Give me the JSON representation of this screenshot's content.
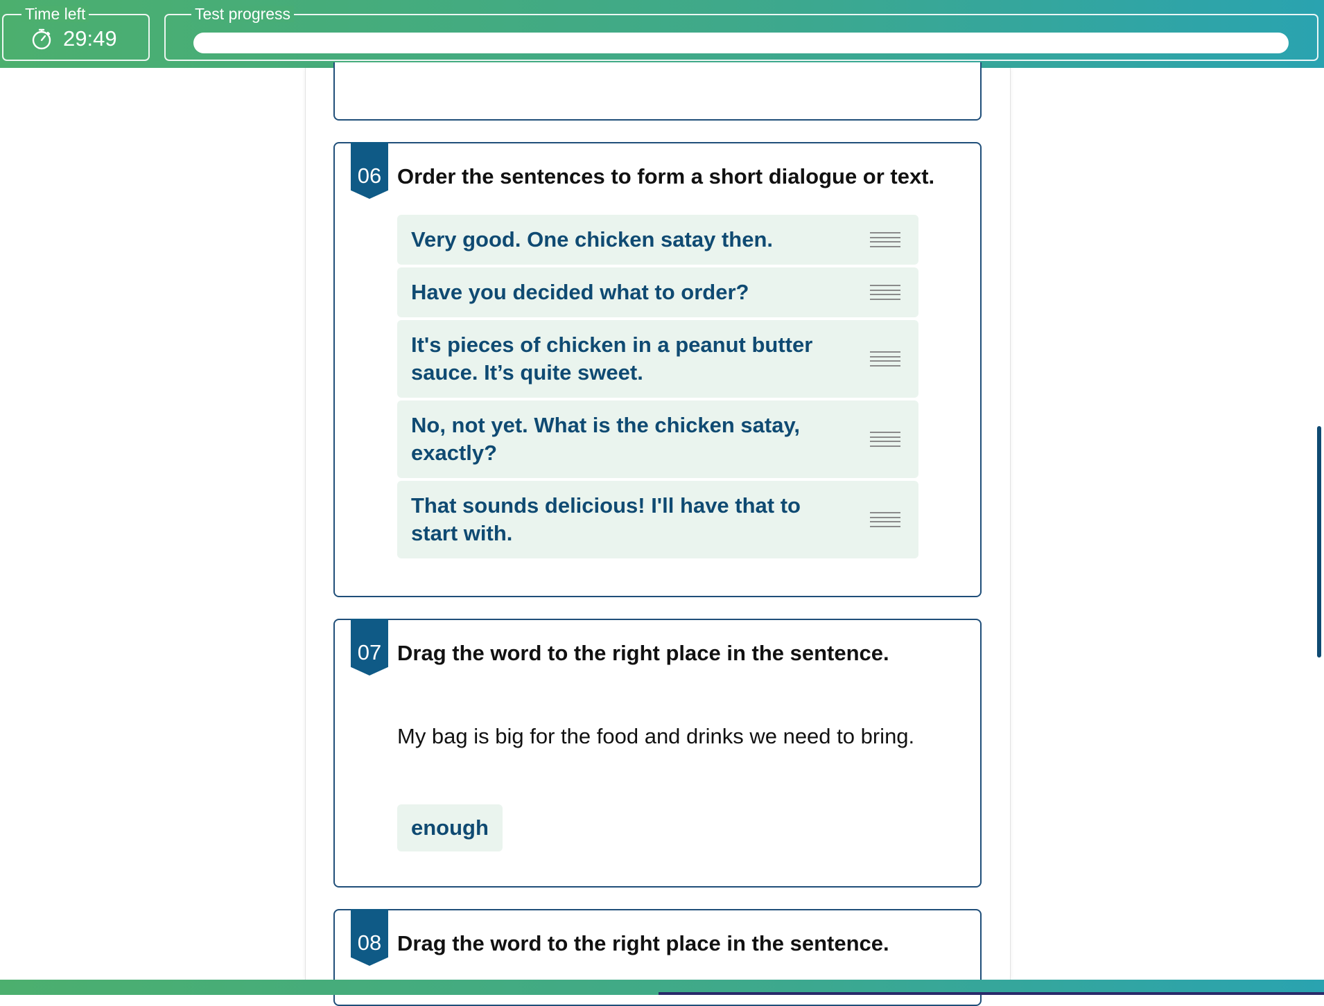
{
  "header": {
    "time_left_label": "Time left",
    "time_left_value": "29:49",
    "progress_label": "Test progress",
    "progress_fraction": 0.0
  },
  "questions": [
    {
      "number": "06",
      "title": "Order the sentences to form a short dialogue or text.",
      "items": [
        "Very good. One chicken satay then.",
        "Have you decided what to order?",
        "It's pieces of chicken in a peanut butter sauce. It’s quite sweet.",
        "No, not yet. What is the chicken satay, exactly?",
        "That sounds delicious! I'll have that to start with."
      ]
    },
    {
      "number": "07",
      "title": "Drag the word to the right place in the sentence.",
      "sentence": "My bag is big for the food and drinks we need to bring.",
      "word": "enough"
    },
    {
      "number": "08",
      "title": "Drag the word to the right place in the sentence."
    }
  ],
  "colors": {
    "header_gradient_start": "#4caf6e",
    "header_gradient_end": "#2aa3b0",
    "card_border": "#1f4e79",
    "badge": "#0f5a86",
    "item_bg": "#eaf4ee",
    "item_text": "#0f4a72"
  },
  "icons": {
    "timer": "stopwatch-icon",
    "drag": "drag-handle-icon"
  }
}
